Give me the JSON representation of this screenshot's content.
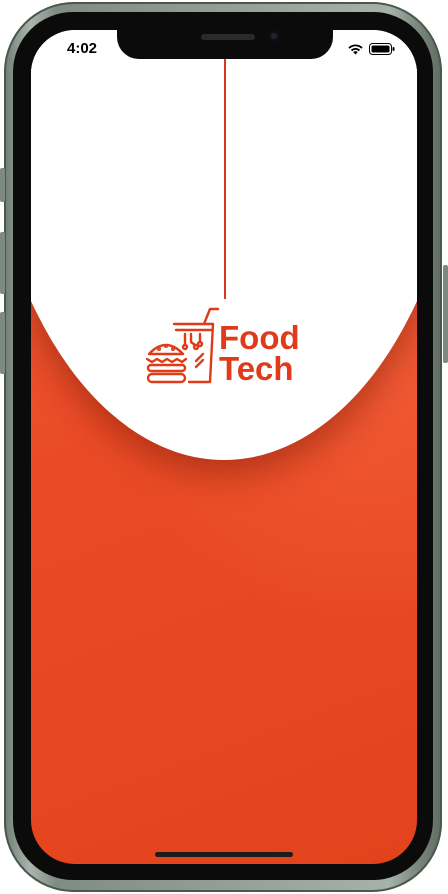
{
  "status_bar": {
    "time": "4:02",
    "wifi_icon": "wifi-icon",
    "battery_icon": "battery-icon"
  },
  "splash": {
    "logo_icon": "food-tech-logo-icon",
    "brand_line1": "Food",
    "brand_line2": "Tech"
  },
  "colors": {
    "brand_red": "#e03b18",
    "background_red": "#ea4b26",
    "top_panel": "#ffffff"
  }
}
